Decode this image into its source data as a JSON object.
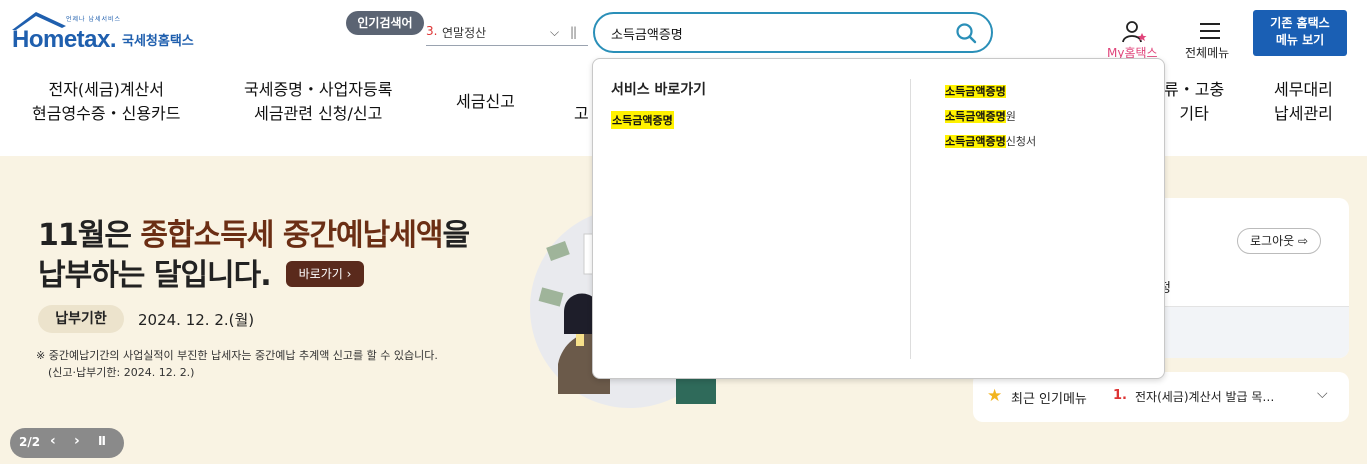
{
  "header": {
    "logo_tagline": "언제나 납세서비스",
    "logo_main": "Hometax.",
    "logo_sub": "국세청홈택스",
    "popular_search_label": "인기검색어",
    "popular_search_rank": "3.",
    "popular_search_term": "연말정산",
    "search_value": "소득금액증명",
    "my_hometax": "My홈택스",
    "all_menu": "전체메뉴",
    "legacy_button": "기존 홈택스\n메뉴 보기"
  },
  "nav": {
    "items": [
      {
        "label": "전자(세금)계산서\n현금영수증・신용카드"
      },
      {
        "label": "국세증명・사업자등록\n세금관련 신청/신고"
      },
      {
        "label": "세금신고"
      },
      {
        "label": "고"
      },
      {
        "label": "류・고충\n기타"
      },
      {
        "label": "세무대리\n납세관리"
      }
    ]
  },
  "autocomplete": {
    "service_shortcut_title": "서비스 바로가기",
    "service_shortcut_item": "소득금액증명",
    "suggestions": [
      {
        "match": "소득금액증명",
        "rest": ""
      },
      {
        "match": "소득금액증명",
        "rest": "원"
      },
      {
        "match": "소득금액증명",
        "rest": "신청서"
      }
    ]
  },
  "banner": {
    "headline_prefix": "11월은 ",
    "headline_highlight": "종합소득세 중간예납세액",
    "headline_suffix": "을",
    "headline_line2": "납부하는 달입니다.",
    "go_button": "바로가기 ›",
    "deadline_label": "납부기한",
    "deadline_date": "2024. 12. 2.(월)",
    "notice_line1": "※ 중간예납기간의 사업실적이 부진한 납세자는 중간예납 추계액 신고를 할 수 있습니다.",
    "notice_line2": "(신고·납부기한: 2024. 12. 2.)",
    "slide_counter": "2/2",
    "slide_prev": "‹",
    "slide_next": "›",
    "slide_pause": "II"
  },
  "login_card": {
    "logout_button": "로그아웃 ⇨",
    "partial_text": "정"
  },
  "popular_menu": {
    "title": "최근 인기메뉴",
    "rank": "1.",
    "item": "전자(세금)계산서 발급 목…"
  },
  "colors": {
    "brand_blue": "#1f5fae",
    "search_border": "#2a8fb8",
    "highlight_yellow": "#fff200",
    "banner_bg": "#f9f3e3",
    "banner_highlight": "#6b2e14"
  }
}
